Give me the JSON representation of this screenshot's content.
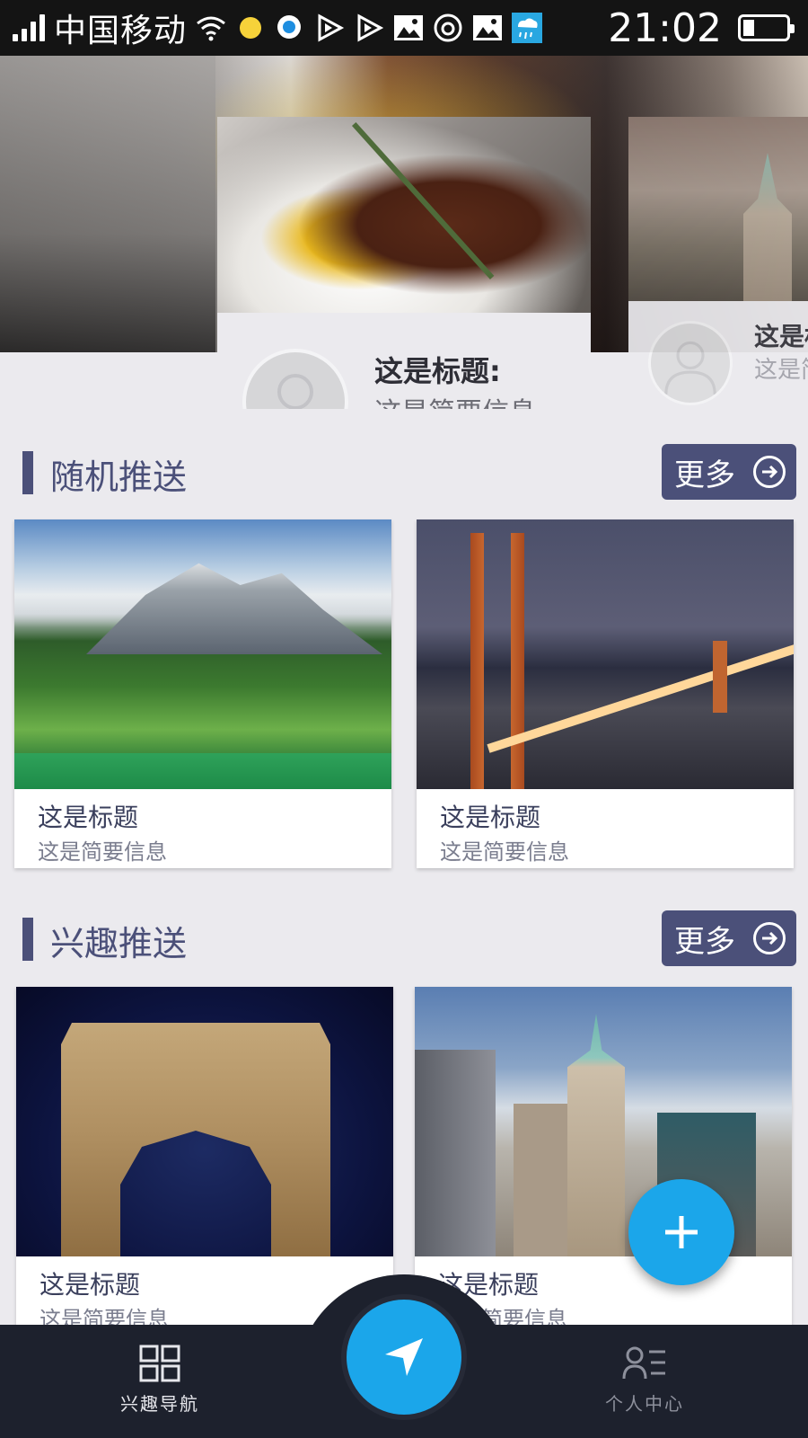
{
  "status_bar": {
    "carrier": "中国移动",
    "time": "21:02",
    "icons": [
      "signal-icon",
      "wifi-icon",
      "yellow-dot-icon",
      "qq-browser-icon",
      "play-icon",
      "play-icon",
      "gallery-icon",
      "netease-music-icon",
      "gallery-icon",
      "rain-weather-icon",
      "battery-icon"
    ],
    "battery_level": 0.2
  },
  "hero": {
    "feature": {
      "title": "这是标题:",
      "subtitle": "这是简要信息"
    },
    "side": {
      "title": "这是标",
      "subtitle": "这是简"
    }
  },
  "sections": [
    {
      "title": "随机推送",
      "more_label": "更多",
      "cards": [
        {
          "title": "这是标题",
          "subtitle": "这是简要信息",
          "image": "mountain-lake"
        },
        {
          "title": "这是标题",
          "subtitle": "这是简要信息",
          "image": "golden-gate-bridge"
        }
      ]
    },
    {
      "title": "兴趣推送",
      "more_label": "更多",
      "cards": [
        {
          "title": "这是标题",
          "subtitle": "这是简要信息",
          "image": "arc-de-triomphe"
        },
        {
          "title": "这是标题",
          "subtitle": "这是简要信息",
          "image": "city-skyline"
        }
      ]
    }
  ],
  "fab": {
    "icon": "plus-icon"
  },
  "bottom_nav": {
    "left": {
      "label": "兴趣导航",
      "icon": "grid-icon"
    },
    "center": {
      "icon": "navigation-arrow-icon"
    },
    "right": {
      "label": "个人中心",
      "icon": "user-list-icon"
    }
  },
  "colors": {
    "accent": "#4b5079",
    "fab": "#1ba6ea",
    "nav_bg": "#1d212d",
    "page_bg": "#ebeaee"
  }
}
